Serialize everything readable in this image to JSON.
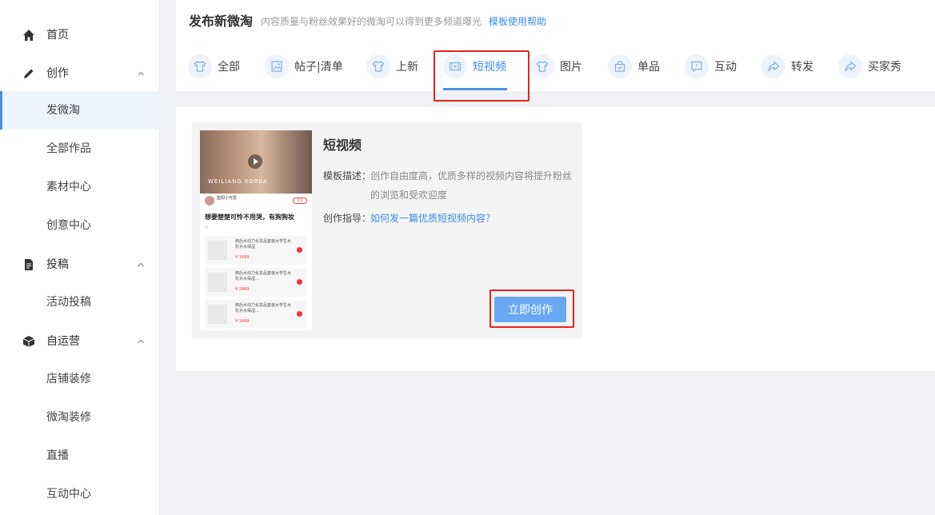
{
  "colors": {
    "accent": "#3b8be8",
    "active_bg": "#eef4fd",
    "highlight": "#e5231e",
    "button": "#6aa9f2"
  },
  "sidebar": {
    "items": [
      {
        "label": "首页",
        "icon": "home-icon",
        "type": "top"
      },
      {
        "label": "创作",
        "icon": "pencil-icon",
        "type": "group"
      },
      {
        "label": "发微淘",
        "type": "sub",
        "active": true
      },
      {
        "label": "全部作品",
        "type": "sub"
      },
      {
        "label": "素材中心",
        "type": "sub"
      },
      {
        "label": "创意中心",
        "type": "sub"
      },
      {
        "label": "投稿",
        "icon": "document-icon",
        "type": "group"
      },
      {
        "label": "活动投稿",
        "type": "sub"
      },
      {
        "label": "自运营",
        "icon": "box-icon",
        "type": "group"
      },
      {
        "label": "店铺装修",
        "type": "sub"
      },
      {
        "label": "微淘装修",
        "type": "sub"
      },
      {
        "label": "直播",
        "type": "sub"
      },
      {
        "label": "互动中心",
        "type": "sub"
      }
    ]
  },
  "header": {
    "title": "发布新微淘",
    "subtitle": "内容质量与粉丝效果好的微淘可以得到更多频道曝光",
    "help_link": "模板使用帮助"
  },
  "tabs": [
    {
      "label": "全部",
      "icon": "tshirt-icon"
    },
    {
      "label": "帖子|清单",
      "icon": "image-list-icon"
    },
    {
      "label": "上新",
      "icon": "tshirt-icon"
    },
    {
      "label": "短视频",
      "icon": "video-icon",
      "active": true
    },
    {
      "label": "图片",
      "icon": "tshirt-icon"
    },
    {
      "label": "单品",
      "icon": "shopping-bag-icon"
    },
    {
      "label": "互动",
      "icon": "chat-icon"
    },
    {
      "label": "转发",
      "icon": "forward-icon"
    },
    {
      "label": "买家秀",
      "icon": "forward-icon"
    }
  ],
  "template_card": {
    "title": "短视频",
    "desc_label": "模板描述：",
    "desc_text": "创作自由度高，优质多样的视频内容将提升粉丝的浏览和受欢迎度",
    "guide_label": "创作指导：",
    "guide_link": "如何发一篇优质短视频内容？",
    "create_button": "立即创作",
    "preview": {
      "brand": "WEILIANG KOREA",
      "author": "蓝阳小可爱",
      "follow": "关注",
      "post_title": "想要楚楚可怜不用哭，有狗狗妆",
      "products": [
        {
          "title": "韩后水动力化妆品套装女学生水乳补水保湿",
          "price": "¥ 1499"
        },
        {
          "title": "韩后水动力化妆品套装女学生水乳补水保湿…",
          "price": "¥ 2499"
        },
        {
          "title": "韩后水动力化妆品套装女学生水乳补水保湿…",
          "price": "¥ 1499"
        }
      ]
    }
  }
}
